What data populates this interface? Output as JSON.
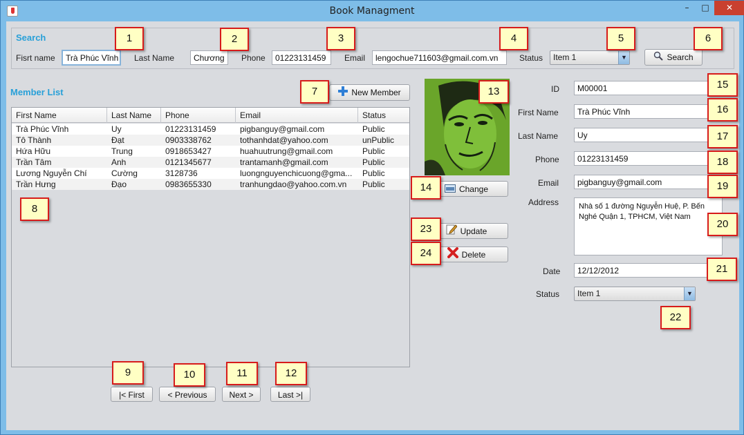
{
  "window": {
    "title": "Book Managment",
    "minimize": "–",
    "maximize": "□",
    "close": "✕"
  },
  "search": {
    "title": "Search",
    "first_name_label": "Fisrt name",
    "first_name_value": "Trà Phúc Vĩnh",
    "last_name_label": "Last Name",
    "last_name_value": "Chương",
    "phone_label": "Phone",
    "phone_value": "01223131459",
    "email_label": "Email",
    "email_value": "lengochue711603@gmail.com.vn",
    "status_label": "Status",
    "status_value": "Item 1",
    "search_button": "Search"
  },
  "members": {
    "title": "Member List",
    "new_member_button": "New Member",
    "columns": [
      "First Name",
      "Last Name",
      "Phone",
      "Email",
      "Status"
    ],
    "rows": [
      [
        "Trà Phúc Vĩnh",
        "Uy",
        "01223131459",
        "pigbanguy@gmail.com",
        "Public"
      ],
      [
        "Tô Thành",
        "Đạt",
        "0903338762",
        "tothanhdat@yahoo.com",
        "unPublic"
      ],
      [
        "Hứa Hữu",
        "Trung",
        "0918653427",
        "huahuutrung@gmail.com",
        "Public"
      ],
      [
        "Trần Tâm",
        "Anh",
        "0121345677",
        "trantamanh@gmail.com",
        "Public"
      ],
      [
        "Lương Nguyễn Chí",
        "Cường",
        "3128736",
        "luongnguyenchicuong@gma...",
        "Public"
      ],
      [
        "Trần Hưng",
        "Đạo",
        "0983655330",
        "tranhungdao@yahoo.com.vn",
        "Public"
      ]
    ]
  },
  "pagination": {
    "first": "|< First",
    "previous": "< Previous",
    "next": "Next >",
    "last": "Last >|"
  },
  "photo_actions": {
    "change": "Change",
    "update": "Update",
    "delete": "Delete"
  },
  "detail": {
    "id_label": "ID",
    "id_value": "M00001",
    "first_name_label": "First Name",
    "first_name_value": "Trà Phúc Vĩnh",
    "last_name_label": "Last Name",
    "last_name_value": "Uy",
    "phone_label": "Phone",
    "phone_value": "01223131459",
    "email_label": "Email",
    "email_value": "pigbanguy@gmail.com",
    "address_label": "Address",
    "address_value": "Nhà số 1 đường Nguyễn Huệ, P. Bến Nghé Quận 1, TPHCM, Việt Nam",
    "date_label": "Date",
    "date_value": "12/12/2012",
    "status_label": "Status",
    "status_value": "Item 1"
  },
  "annotations": [
    "1",
    "2",
    "3",
    "4",
    "5",
    "6",
    "7",
    "8",
    "9",
    "10",
    "11",
    "12",
    "13",
    "14",
    "15",
    "16",
    "17",
    "18",
    "19",
    "20",
    "21",
    "22",
    "23",
    "24"
  ],
  "colors": {
    "accent": "#28a0d8",
    "tag_border": "#d71b1b",
    "tag_fill": "#ffffc4",
    "photo_green": "#6c9e2e"
  }
}
